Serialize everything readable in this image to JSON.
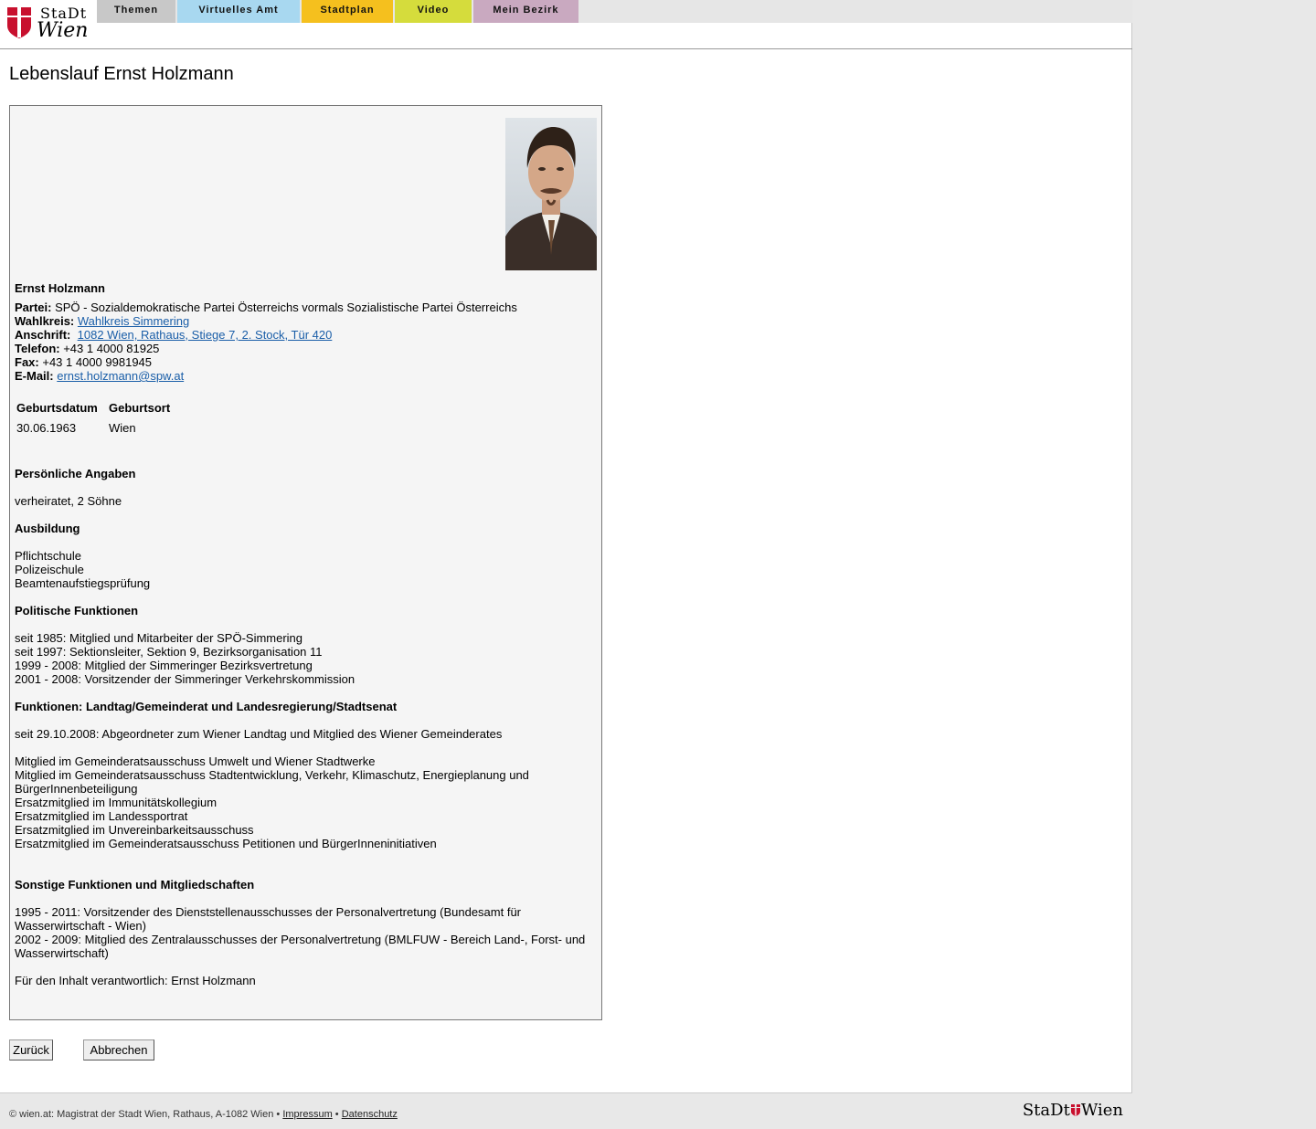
{
  "header": {
    "logo_top": "StaDt",
    "logo_bottom": "Wien",
    "nav": [
      {
        "label": "Themen",
        "color": "#c8c8c8"
      },
      {
        "label": "Virtuelles Amt",
        "color": "#a8d8f0"
      },
      {
        "label": "Stadtplan",
        "color": "#f5c01e"
      },
      {
        "label": "Video",
        "color": "#d5dc3c"
      },
      {
        "label": "Mein Bezirk",
        "color": "#c9a9c0"
      }
    ]
  },
  "page": {
    "title": "Lebenslauf Ernst Holzmann"
  },
  "profile": {
    "name": "Ernst Holzmann",
    "partei_label": "Partei:",
    "partei_value": "SPÖ - Sozialdemokratische Partei Österreichs vormals Sozialistische Partei Österreichs",
    "wahlkreis_label": "Wahlkreis:",
    "wahlkreis_value": "Wahlkreis Simmering",
    "anschrift_label": "Anschrift:",
    "anschrift_value": "1082 Wien, Rathaus, Stiege 7, 2. Stock, Tür 420",
    "telefon_label": "Telefon:",
    "telefon_value": "+43 1 4000 81925",
    "fax_label": "Fax:",
    "fax_value": "+43 1 4000 9981945",
    "email_label": "E-Mail:",
    "email_value": "ernst.holzmann@spw.at"
  },
  "birth": {
    "headers": [
      "Geburtsdatum",
      "Geburtsort"
    ],
    "values": [
      "30.06.1963",
      "Wien"
    ]
  },
  "sections": {
    "personal_heading": "Persönliche Angaben",
    "personal": [
      "verheiratet, 2 Söhne"
    ],
    "education_heading": "Ausbildung",
    "education": [
      "Pflichtschule",
      "Polizeischule",
      "Beamtenaufstiegsprüfung"
    ],
    "political_heading": "Politische Funktionen",
    "political": [
      "seit 1985: Mitglied und Mitarbeiter der SPÖ-Simmering",
      "seit 1997: Sektionsleiter, Sektion 9, Bezirksorganisation 11",
      "1999 - 2008: Mitglied der Simmeringer Bezirksvertretung",
      "2001 - 2008: Vorsitzender der Simmeringer Verkehrskommission"
    ],
    "landtag_heading": "Funktionen: Landtag/Gemeinderat und Landesregierung/Stadtsenat",
    "landtag_intro": "seit 29.10.2008: Abgeordneter zum Wiener Landtag und Mitglied des Wiener Gemeinderates",
    "landtag": [
      "Mitglied im Gemeinderatsausschuss Umwelt und Wiener Stadtwerke",
      "Mitglied im Gemeinderatsausschuss Stadtentwicklung, Verkehr, Klimaschutz, Energieplanung und BürgerInnenbeteiligung",
      "Ersatzmitglied im Immunitätskollegium",
      "Ersatzmitglied im Landessportrat",
      "Ersatzmitglied im Unvereinbarkeitsausschuss",
      "Ersatzmitglied im Gemeinderatsausschuss Petitionen und BürgerInneninitiativen"
    ],
    "other_heading": "Sonstige Funktionen und Mitgliedschaften",
    "other": [
      "1995 - 2011: Vorsitzender des Dienststellenausschusses der Personalvertretung (Bundesamt für Wasserwirtschaft - Wien)",
      "2002 - 2009: Mitglied des Zentralausschusses der Personalvertretung (BMLFUW - Bereich Land-, Forst- und Wasserwirtschaft)"
    ],
    "responsible": "Für den Inhalt verantwortlich: Ernst Holzmann"
  },
  "buttons": {
    "back": "Zurück",
    "cancel": "Abbrechen"
  },
  "footer": {
    "text": "© wien.at: Magistrat der Stadt Wien, Rathaus, A-1082 Wien •",
    "impressum": "Impressum",
    "separator": "•",
    "datenschutz": "Datenschutz",
    "logo_left": "StaDt",
    "logo_right": "Wien"
  }
}
